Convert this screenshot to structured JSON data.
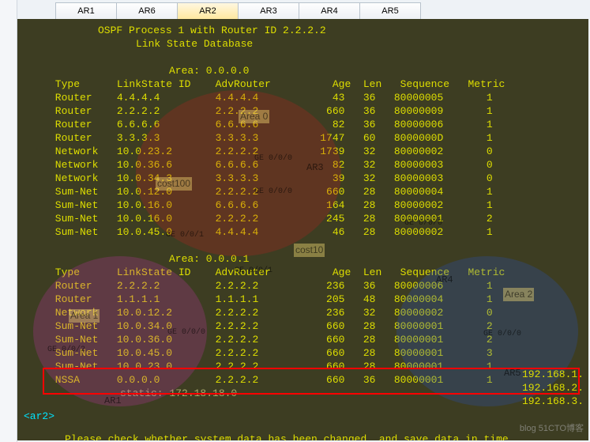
{
  "tabs": [
    "AR1",
    "AR6",
    "AR2",
    "AR3",
    "AR4",
    "AR5"
  ],
  "active_tab_index": 2,
  "header_line1": "OSPF Process 1 with Router ID 2.2.2.2",
  "header_line2": "Link State Database",
  "area0_label": "Area: 0.0.0.0",
  "area1_label": "Area: 0.0.0.1",
  "columns": [
    "Type",
    "LinkState ID",
    "AdvRouter",
    "Age",
    "Len",
    "Sequence",
    "Metric"
  ],
  "area0_rows": [
    {
      "type": "Router",
      "lsid": "4.4.4.4",
      "adv": "4.4.4.4",
      "age": "43",
      "len": "36",
      "seq": "80000005",
      "metric": "1"
    },
    {
      "type": "Router",
      "lsid": "2.2.2.2",
      "adv": "2.2.2.2",
      "age": "660",
      "len": "36",
      "seq": "80000009",
      "metric": "1"
    },
    {
      "type": "Router",
      "lsid": "6.6.6.6",
      "adv": "6.6.6.6",
      "age": "82",
      "len": "36",
      "seq": "80000006",
      "metric": "1"
    },
    {
      "type": "Router",
      "lsid": "3.3.3.3",
      "adv": "3.3.3.3",
      "age": "1747",
      "len": "60",
      "seq": "8000000D",
      "metric": "1"
    },
    {
      "type": "Network",
      "lsid": "10.0.23.2",
      "adv": "2.2.2.2",
      "age": "1739",
      "len": "32",
      "seq": "80000002",
      "metric": "0"
    },
    {
      "type": "Network",
      "lsid": "10.0.36.6",
      "adv": "6.6.6.6",
      "age": "82",
      "len": "32",
      "seq": "80000003",
      "metric": "0"
    },
    {
      "type": "Network",
      "lsid": "10.0.34.3",
      "adv": "3.3.3.3",
      "age": "39",
      "len": "32",
      "seq": "80000003",
      "metric": "0"
    },
    {
      "type": "Sum-Net",
      "lsid": "10.0.12.0",
      "adv": "2.2.2.2",
      "age": "660",
      "len": "28",
      "seq": "80000004",
      "metric": "1"
    },
    {
      "type": "Sum-Net",
      "lsid": "10.0.16.0",
      "adv": "6.6.6.6",
      "age": "164",
      "len": "28",
      "seq": "80000002",
      "metric": "1"
    },
    {
      "type": "Sum-Net",
      "lsid": "10.0.16.0",
      "adv": "2.2.2.2",
      "age": "245",
      "len": "28",
      "seq": "80000001",
      "metric": "2"
    },
    {
      "type": "Sum-Net",
      "lsid": "10.0.45.0",
      "adv": "4.4.4.4",
      "age": "46",
      "len": "28",
      "seq": "80000002",
      "metric": "1"
    }
  ],
  "area1_rows": [
    {
      "type": "Router",
      "lsid": "2.2.2.2",
      "adv": "2.2.2.2",
      "age": "236",
      "len": "36",
      "seq": "80000006",
      "metric": "1"
    },
    {
      "type": "Router",
      "lsid": "1.1.1.1",
      "adv": "1.1.1.1",
      "age": "205",
      "len": "48",
      "seq": "80000004",
      "metric": "1"
    },
    {
      "type": "Network",
      "lsid": "10.0.12.2",
      "adv": "2.2.2.2",
      "age": "236",
      "len": "32",
      "seq": "80000002",
      "metric": "0"
    },
    {
      "type": "Sum-Net",
      "lsid": "10.0.34.0",
      "adv": "2.2.2.2",
      "age": "660",
      "len": "28",
      "seq": "80000001",
      "metric": "2"
    },
    {
      "type": "Sum-Net",
      "lsid": "10.0.36.0",
      "adv": "2.2.2.2",
      "age": "660",
      "len": "28",
      "seq": "80000001",
      "metric": "2"
    },
    {
      "type": "Sum-Net",
      "lsid": "10.0.45.0",
      "adv": "2.2.2.2",
      "age": "660",
      "len": "28",
      "seq": "80000001",
      "metric": "3"
    },
    {
      "type": "Sum-Net",
      "lsid": "10.0.23.0",
      "adv": "2.2.2.2",
      "age": "660",
      "len": "28",
      "seq": "80000001",
      "metric": "1"
    },
    {
      "type": "NSSA",
      "lsid": "0.0.0.0",
      "adv": "2.2.2.2",
      "age": "660",
      "len": "36",
      "seq": "80000001",
      "metric": "1"
    }
  ],
  "highlight_static": "static: 172.18.18.0",
  "prompt": "<ar2>",
  "footer_msg": "Please check whether system data has been changed, and save data in time",
  "extra_ips": [
    "192.168.1.",
    "192.168.2.",
    "192.168.3."
  ],
  "ghosts": {
    "area0": "Area 0",
    "area1": "Area 1",
    "area2": "Area 2",
    "ar1": "AR1",
    "ar3": "AR3",
    "ar4": "AR4",
    "ar5": "AR5",
    "cost100": "cost100",
    "cost10": "cost10",
    "ge0": "GE 0/0/0",
    "ge1": "GE 0/0/1",
    "ge2": "GE 0/0/2"
  },
  "watermark": "blog 51CTO博客"
}
